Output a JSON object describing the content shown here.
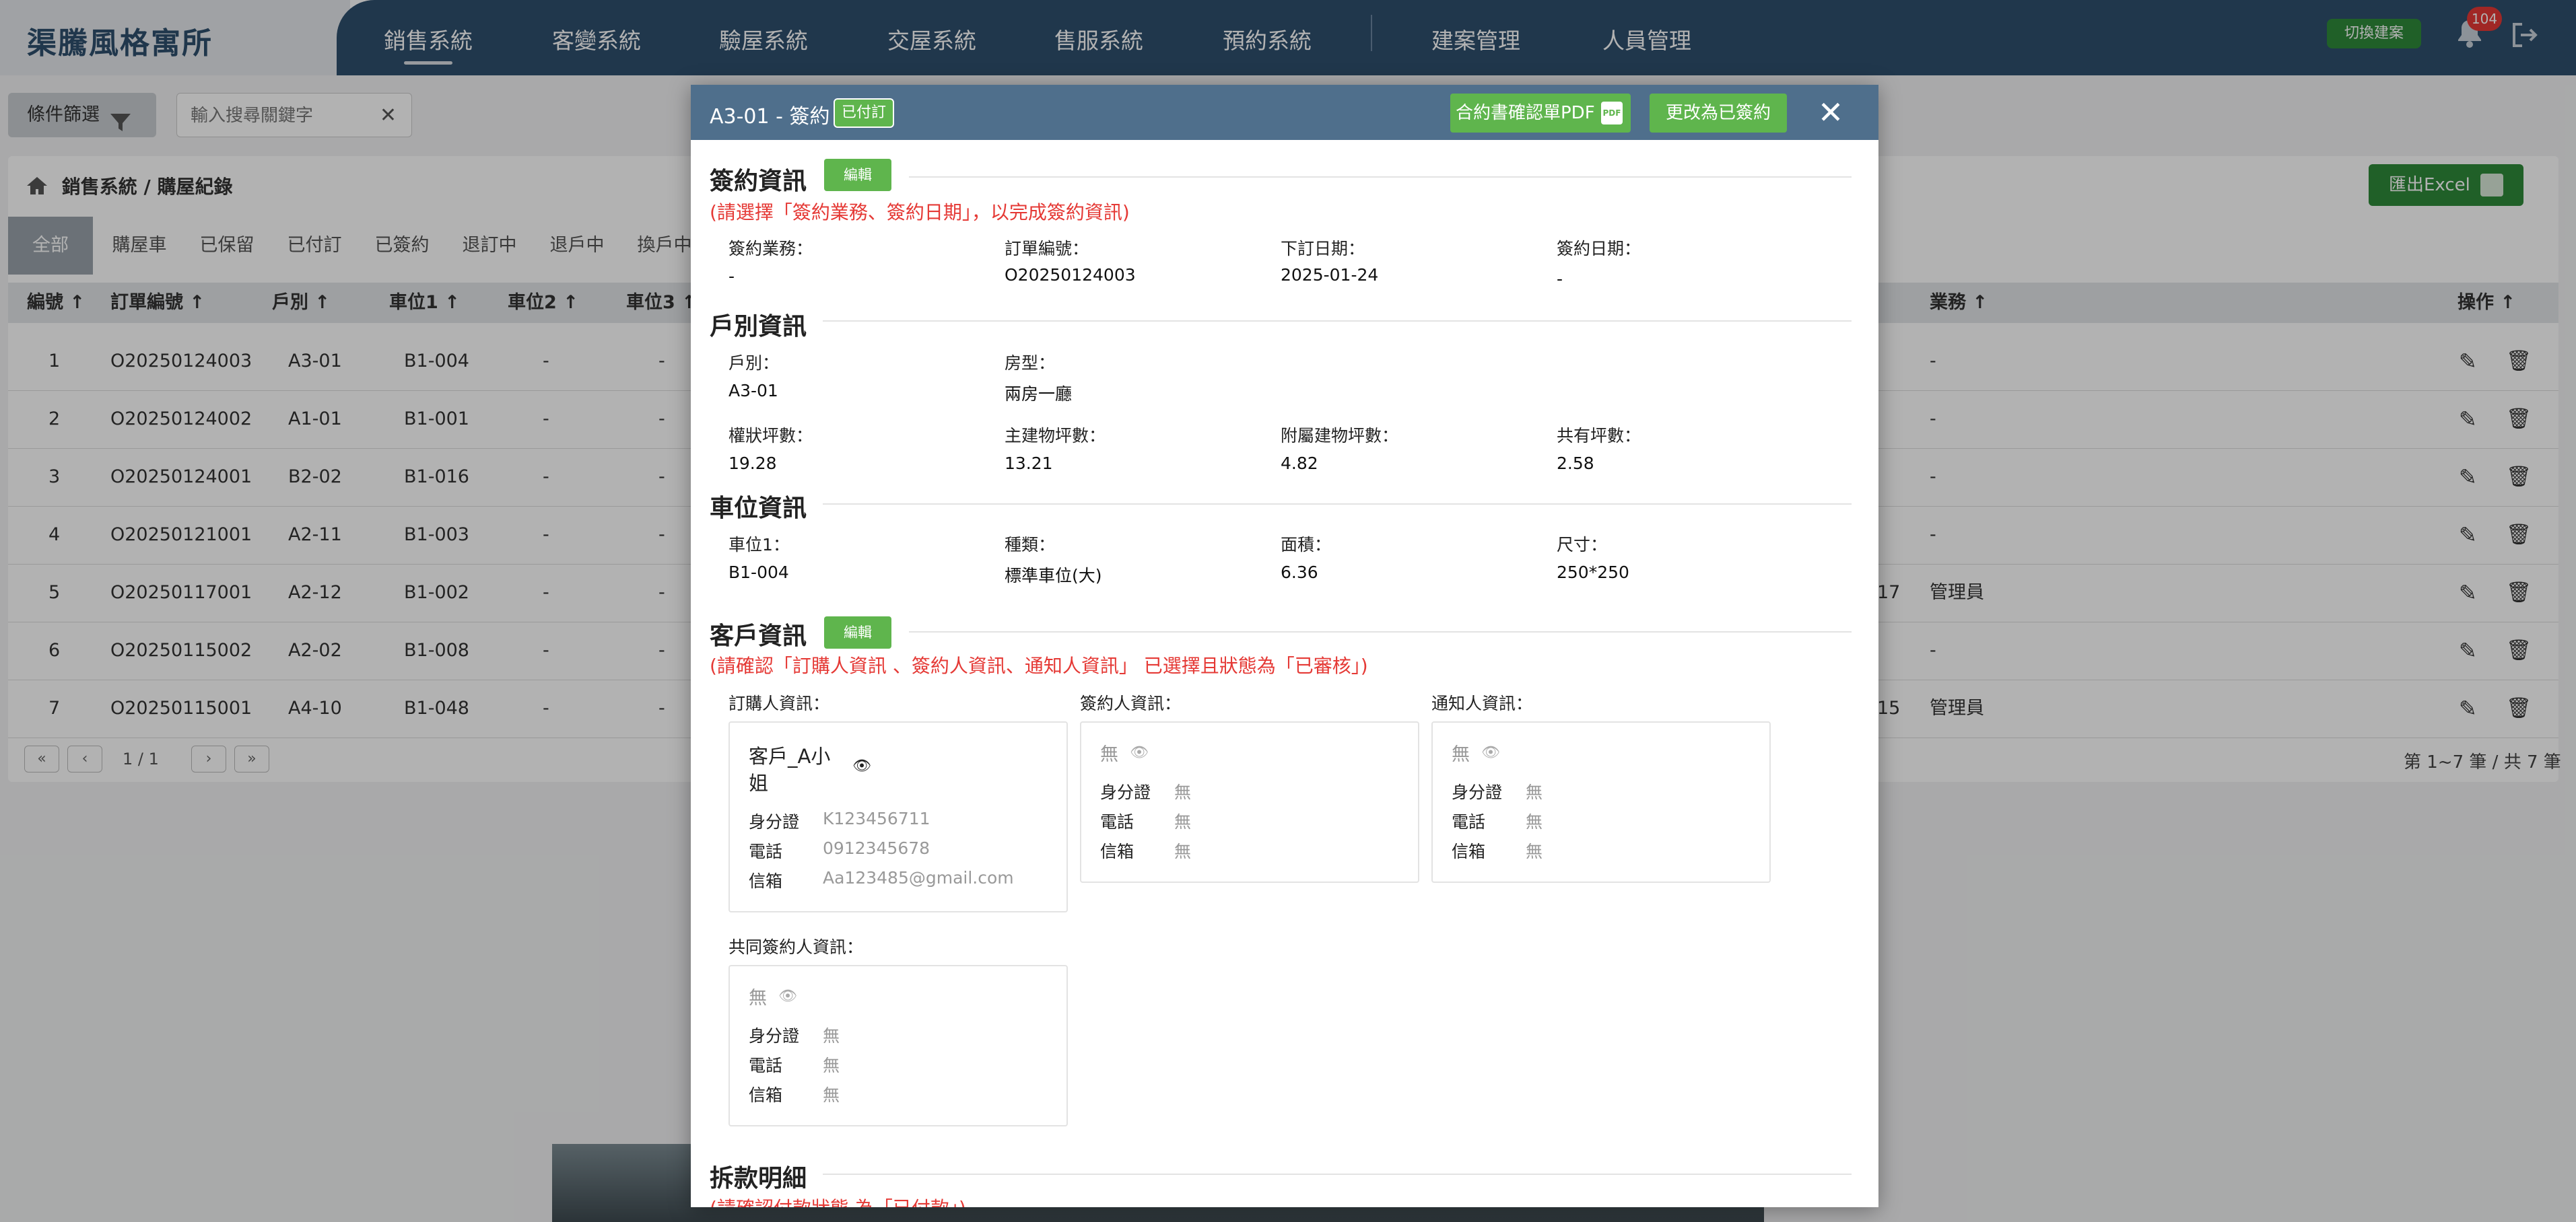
{
  "header": {
    "brand": "渠騰風格寓所",
    "nav": [
      "銷售系統",
      "客變系統",
      "驗屋系統",
      "交屋系統",
      "售服系統",
      "預約系統"
    ],
    "nav_admin": [
      "建案管理",
      "人員管理"
    ],
    "switch_label": "切換建案",
    "notification_count": "104"
  },
  "toolbar": {
    "filter_label": "條件篩選",
    "search_placeholder": "輸入搜尋關鍵字"
  },
  "page": {
    "breadcrumb": "銷售系統 / 購屋紀錄",
    "export_label": "匯出Excel",
    "tabs": [
      "全部",
      "購屋車",
      "已保留",
      "已付訂",
      "已簽約",
      "退訂中",
      "退戶中",
      "換戶中"
    ],
    "columns": [
      "編號",
      "訂單編號",
      "戶別",
      "車位1",
      "車位2",
      "車位3",
      "業務",
      "操作"
    ],
    "rows": [
      {
        "no": "1",
        "order": "O20250124003",
        "unit": "A3-01",
        "p1": "B1-004",
        "p2": "-",
        "p3": "-",
        "extra": "",
        "sales": "-"
      },
      {
        "no": "2",
        "order": "O20250124002",
        "unit": "A1-01",
        "p1": "B1-001",
        "p2": "-",
        "p3": "-",
        "extra": "",
        "sales": "-"
      },
      {
        "no": "3",
        "order": "O20250124001",
        "unit": "B2-02",
        "p1": "B1-016",
        "p2": "-",
        "p3": "-",
        "extra": "",
        "sales": "-"
      },
      {
        "no": "4",
        "order": "O20250121001",
        "unit": "A2-11",
        "p1": "B1-003",
        "p2": "-",
        "p3": "-",
        "extra": "",
        "sales": "-"
      },
      {
        "no": "5",
        "order": "O20250117001",
        "unit": "A2-12",
        "p1": "B1-002",
        "p2": "-",
        "p3": "-",
        "extra": "17",
        "sales": "管理員"
      },
      {
        "no": "6",
        "order": "O20250115002",
        "unit": "A2-02",
        "p1": "B1-008",
        "p2": "-",
        "p3": "-",
        "extra": "",
        "sales": "-"
      },
      {
        "no": "7",
        "order": "O20250115001",
        "unit": "A4-10",
        "p1": "B1-048",
        "p2": "-",
        "p3": "-",
        "extra": "15",
        "sales": "管理員"
      }
    ],
    "pager_text": "1 / 1",
    "count_text": "第 1~7 筆 / 共 7 筆"
  },
  "modal": {
    "title": "A3-01 - 簽約",
    "status_badge": "已付訂",
    "pdf_label": "合約書確認單PDF",
    "signed_label": "更改為已簽約",
    "edit_label": "編輯",
    "sign_section": {
      "title": "簽約資訊",
      "warning": "(請選擇「簽約業務、簽約日期」，以完成簽約資訊)",
      "fields": [
        {
          "label": "簽約業務：",
          "value": "-"
        },
        {
          "label": "訂單編號：",
          "value": "O20250124003"
        },
        {
          "label": "下訂日期：",
          "value": "2025-01-24"
        },
        {
          "label": "簽約日期：",
          "value": "-"
        }
      ]
    },
    "unit_section": {
      "title": "戶別資訊",
      "fields": [
        {
          "label": "戶別：",
          "value": "A3-01"
        },
        {
          "label": "房型：",
          "value": "兩房一廳"
        },
        {
          "label": "權狀坪數：",
          "value": "19.28"
        },
        {
          "label": "主建物坪數：",
          "value": "13.21"
        },
        {
          "label": "附屬建物坪數：",
          "value": "4.82"
        },
        {
          "label": "共有坪數：",
          "value": "2.58"
        }
      ]
    },
    "parking_section": {
      "title": "車位資訊",
      "fields": [
        {
          "label": "車位1：",
          "value": "B1-004"
        },
        {
          "label": "種類：",
          "value": "標準車位(大)"
        },
        {
          "label": "面積：",
          "value": "6.36"
        },
        {
          "label": "尺寸：",
          "value": "250*250"
        }
      ]
    },
    "customer_section": {
      "title": "客戶資訊",
      "warning": "(請確認「訂購人資訊 、簽約人資訊、通知人資訊」 已選擇且狀態為「已審核」)",
      "field_labels": {
        "id": "身分證",
        "phone": "電話",
        "email": "信箱"
      },
      "persons": [
        {
          "label": "訂購人資訊：",
          "name": "客戶_A小姐",
          "id": "K123456711",
          "phone": "0912345678",
          "email": "Aa123485@gmail.com"
        },
        {
          "label": "簽約人資訊：",
          "name": "無",
          "id": "無",
          "phone": "無",
          "email": "無"
        },
        {
          "label": "通知人資訊：",
          "name": "無",
          "id": "無",
          "phone": "無",
          "email": "無"
        },
        {
          "label": "共同簽約人資訊：",
          "name": "無",
          "id": "無",
          "phone": "無",
          "email": "無"
        }
      ]
    },
    "payment_section": {
      "title": "拆款明細",
      "warning": "(請確認付款狀態 為「已付款」)"
    }
  },
  "colors": {
    "header_bg": "#2e4f6e",
    "modal_header_bg": "#4f6f8c",
    "accent_green": "#5fb54d",
    "warning_red": "#e53935"
  }
}
